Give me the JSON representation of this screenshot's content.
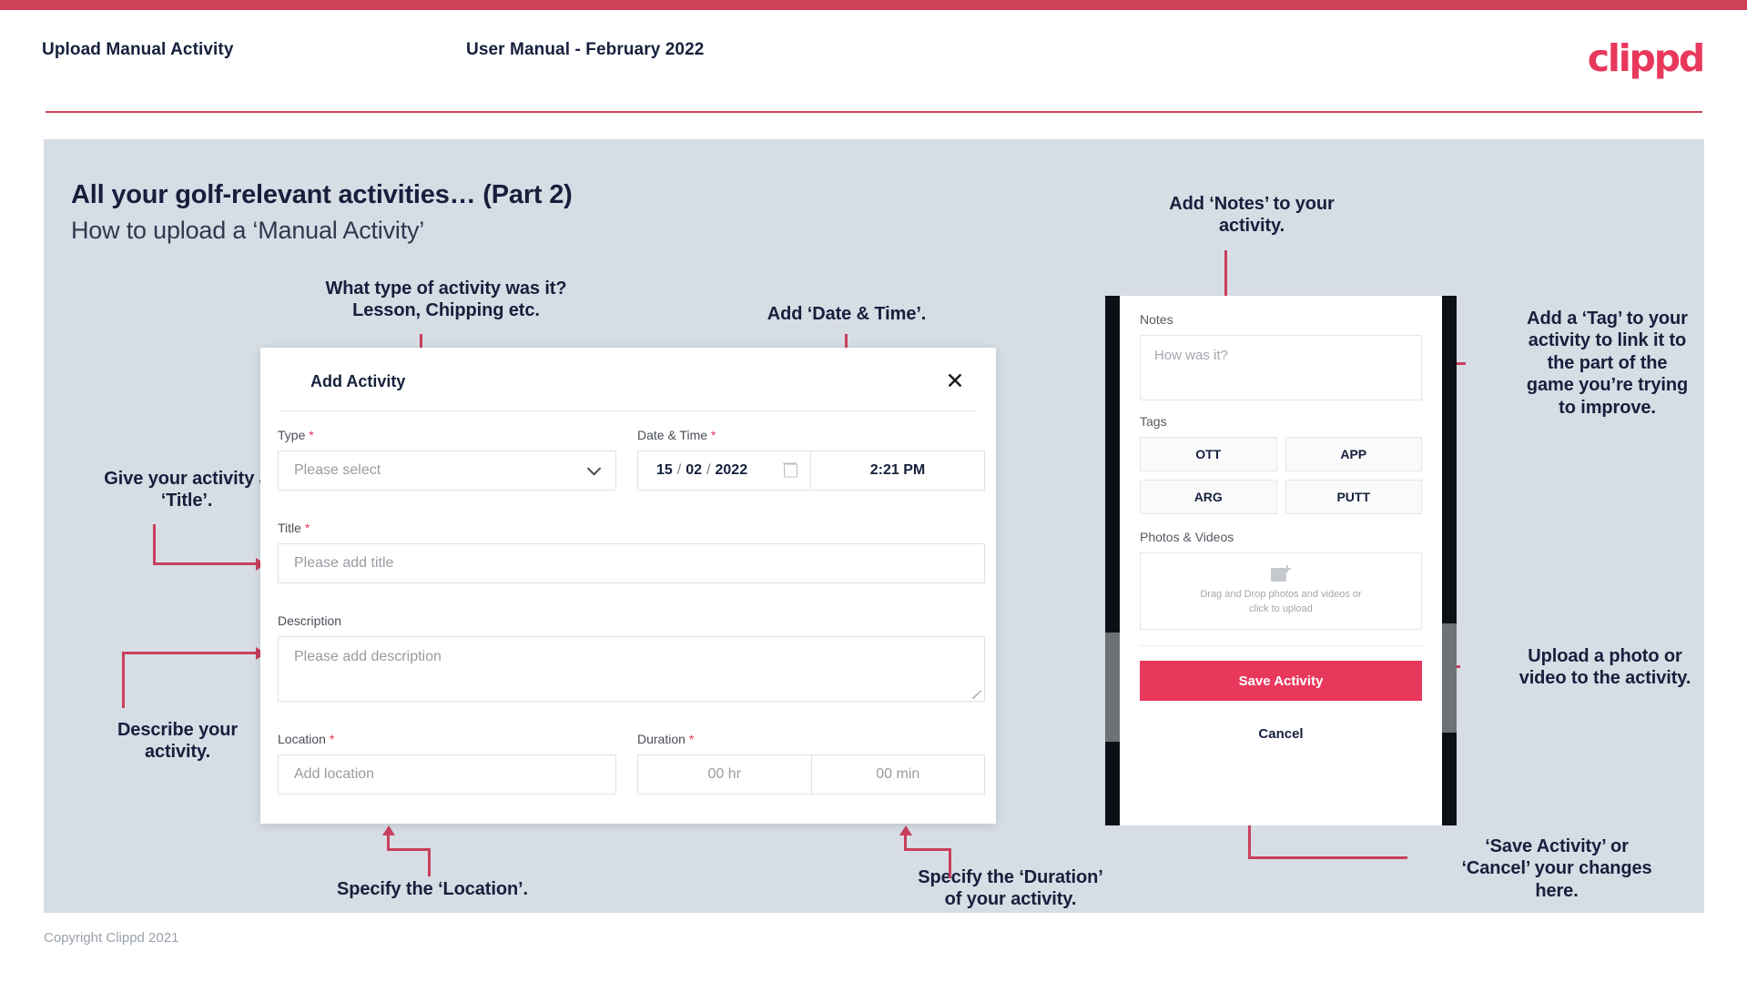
{
  "header": {
    "title": "Upload Manual Activity",
    "subtitle": "User Manual - February 2022",
    "logo": "clippd"
  },
  "slide": {
    "title": "All your golf-relevant activities… (Part 2)",
    "subtitle": "How to upload a ‘Manual Activity’"
  },
  "annotations": {
    "type": "What type of activity was it?\nLesson, Chipping etc.",
    "datetime": "Add ‘Date & Time’.",
    "title": "Give your activity a\n‘Title’.",
    "description": "Describe your\nactivity.",
    "location": "Specify the ‘Location’.",
    "duration": "Specify the ‘Duration’\nof your activity.",
    "notes": "Add ‘Notes’ to your\nactivity.",
    "tags": "Add a ‘Tag’ to your\nactivity to link it to\nthe part of the\ngame you’re trying\nto improve.",
    "upload": "Upload a photo or\nvideo to the activity.",
    "save": "‘Save Activity’ or\n‘Cancel’ your changes\nhere."
  },
  "dialog": {
    "title": "Add Activity",
    "close_icon": "close-icon",
    "fields": {
      "type": {
        "label": "Type",
        "required": "*",
        "placeholder": "Please select",
        "chevron_icon": "chevron-down-icon"
      },
      "datetime": {
        "label": "Date & Time",
        "required": "*",
        "day": "15",
        "sep1": "/",
        "month": "02",
        "sep2": "/",
        "year": "2022",
        "calendar_icon": "calendar-icon",
        "time": "2:21 PM"
      },
      "title": {
        "label": "Title",
        "required": "*",
        "placeholder": "Please add title"
      },
      "description": {
        "label": "Description",
        "placeholder": "Please add description"
      },
      "location": {
        "label": "Location",
        "required": "*",
        "placeholder": "Add location"
      },
      "duration": {
        "label": "Duration",
        "required": "*",
        "hours_placeholder": "00 hr",
        "minutes_placeholder": "00 min"
      }
    }
  },
  "phone": {
    "notes": {
      "label": "Notes",
      "placeholder": "How was it?"
    },
    "tags": {
      "label": "Tags",
      "items": [
        "OTT",
        "APP",
        "ARG",
        "PUTT"
      ]
    },
    "photos": {
      "label": "Photos & Videos",
      "icon": "add-image-icon",
      "line1": "Drag and Drop photos and videos or",
      "line2": "click to upload"
    },
    "save_label": "Save Activity",
    "cancel_label": "Cancel"
  },
  "footer": {
    "copyright": "Copyright Clippd 2021"
  },
  "colors": {
    "brand_red": "#e8385c",
    "bar_red": "#cf4159",
    "connector_red": "#c8405e",
    "slide_bg": "#d7dde5",
    "text_dark": "#16203c"
  }
}
